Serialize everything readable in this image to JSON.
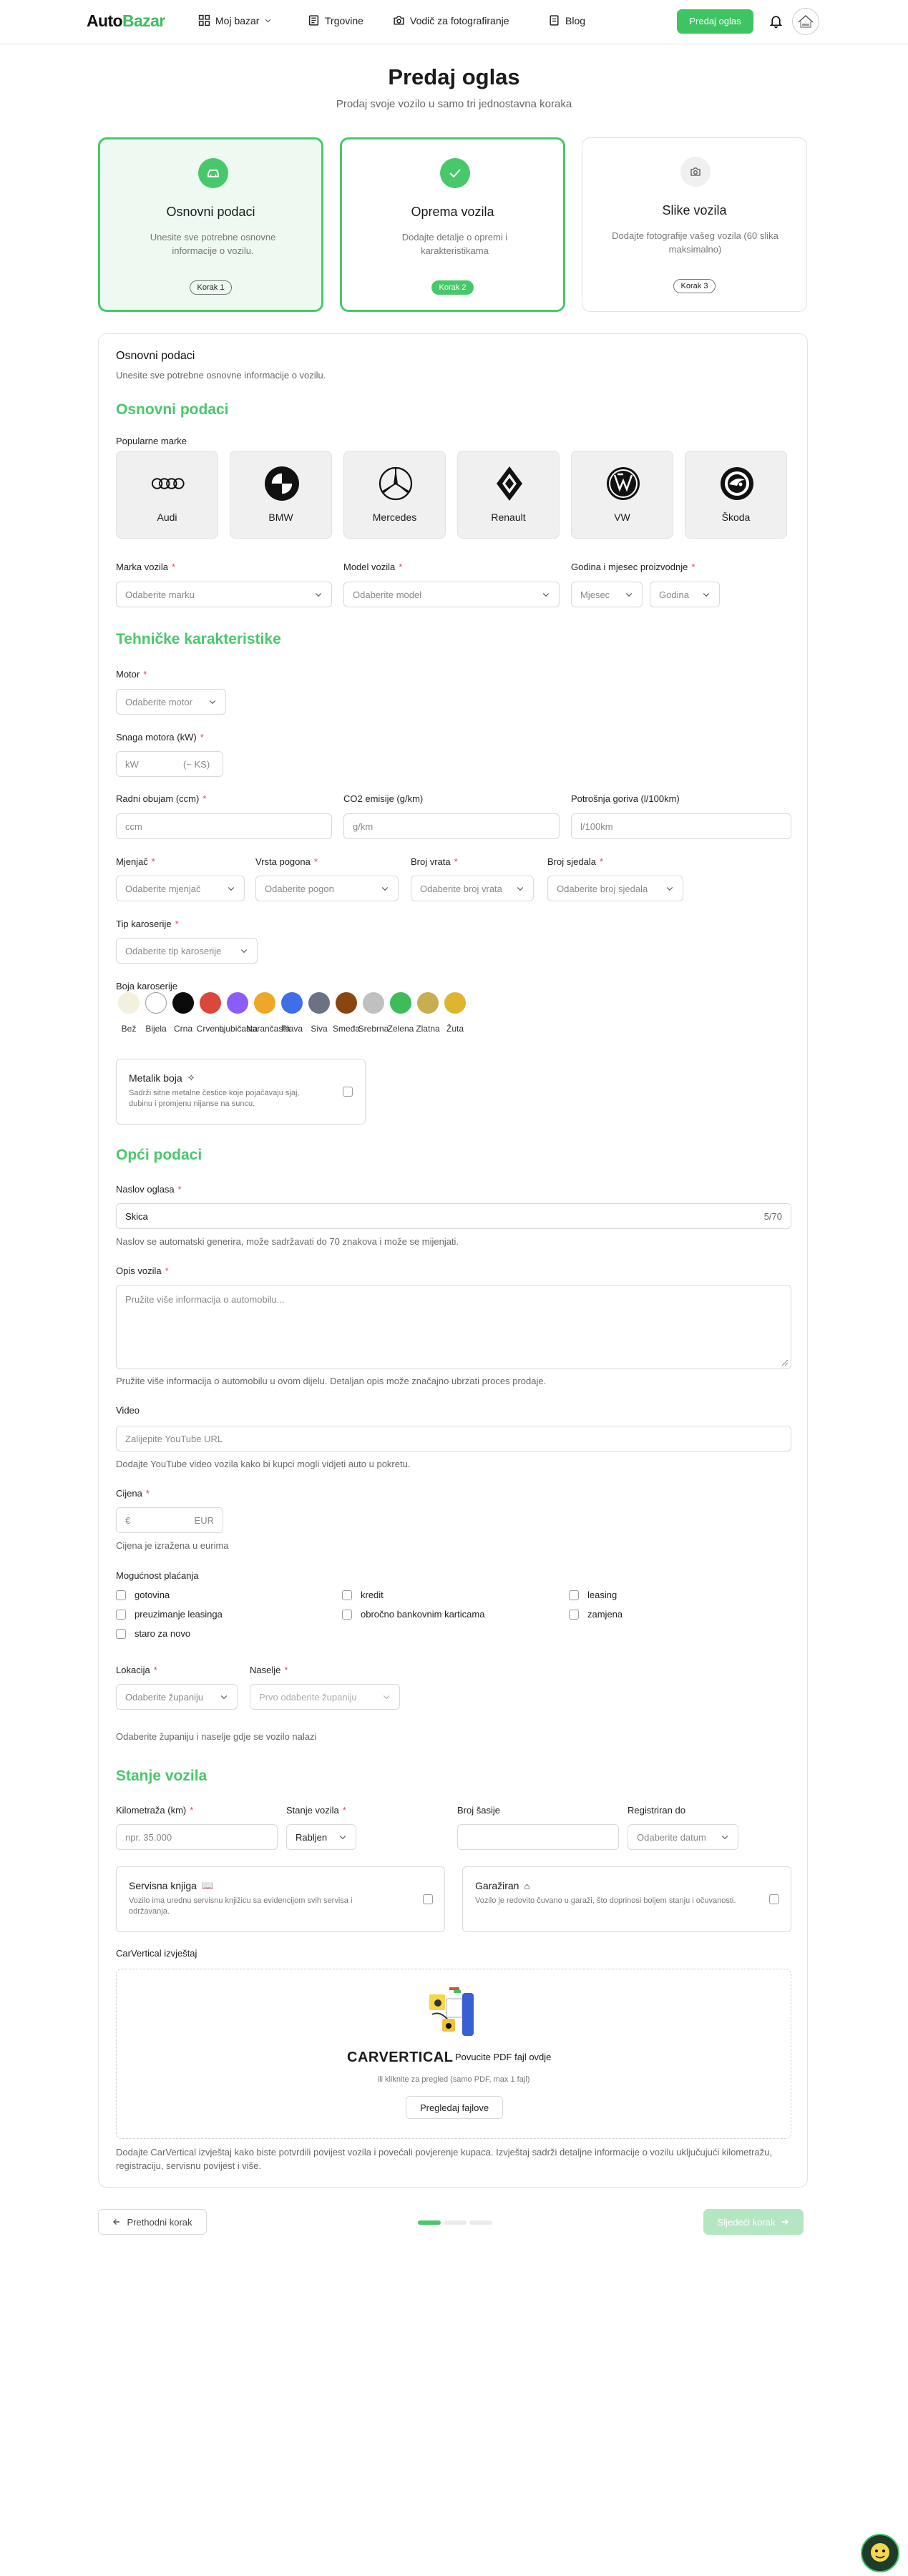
{
  "nav": {
    "logo_a": "Auto",
    "logo_b": "Bazar",
    "moj_bazar": "Moj bazar",
    "trgovine": "Trgovine",
    "vodic": "Vodič za fotografiranje",
    "blog": "Blog",
    "sell": "Predaj oglas"
  },
  "hero": {
    "title": "Predaj oglas",
    "subtitle": "Prodaj svoje vozilo u samo tri jednostavna koraka"
  },
  "steps": [
    {
      "title": "Osnovni podaci",
      "desc": "Unesite sve potrebne osnovne informacije o vozilu.",
      "badge": "Korak 1"
    },
    {
      "title": "Oprema vozila",
      "desc": "Dodajte detalje o opremi i karakteristikama",
      "badge": "Korak 2"
    },
    {
      "title": "Slike vozila",
      "desc": "Dodajte fotografije vašeg vozila (60 slika maksimalno)",
      "badge": "Korak 3"
    }
  ],
  "form": {
    "card_title": "Osnovni podaci",
    "card_sub": "Unesite sve potrebne osnovne informacije o vozilu.",
    "sec1": "Osnovni podaci",
    "popular": "Popularne marke",
    "brands": [
      "Audi",
      "BMW",
      "Mercedes",
      "Renault",
      "VW",
      "Škoda"
    ],
    "marka_label": "Marka vozila",
    "marka_ph": "Odaberite marku",
    "model_label": "Model vozila",
    "model_ph": "Odaberite model",
    "godina_label": "Godina i mjesec proizvodnje",
    "mjesec_ph": "Mjesec",
    "godina_ph": "Godina",
    "sec2": "Tehničke karakteristike",
    "motor_label": "Motor",
    "motor_ph": "Odaberite motor",
    "snaga_label": "Snaga motora (kW)",
    "kw_ph": "kW",
    "ks": "(~ KS)",
    "obujam_label": "Radni obujam (ccm)",
    "obujam_ph": "ccm",
    "co2_label": "CO2 emisije (g/km)",
    "co2_ph": "g/km",
    "potrosnja_label": "Potrošnja goriva (l/100km)",
    "potrosnja_ph": "l/100km",
    "mjenjac_label": "Mjenjač",
    "mjenjac_ph": "Odaberite mjenjač",
    "pogon_label": "Vrsta pogona",
    "pogon_ph": "Odaberite pogon",
    "vrata_label": "Broj vrata",
    "vrata_ph": "Odaberite broj vrata",
    "sjedala_label": "Broj sjedala",
    "sjedala_ph": "Odaberite broj sjedala",
    "karoserija_label": "Tip karoserije",
    "karoserija_ph": "Odaberite tip karoserije",
    "boja_label": "Boja karoserije",
    "colors": [
      {
        "name": "Bež",
        "hex": "#f3f0dd"
      },
      {
        "name": "Bijela",
        "hex": "#ffffff"
      },
      {
        "name": "Crna",
        "hex": "#0b0b0b"
      },
      {
        "name": "Crvena",
        "hex": "#d9483b"
      },
      {
        "name": "Ljubičasta",
        "hex": "#8b5cf6"
      },
      {
        "name": "Narančasta",
        "hex": "#eea727"
      },
      {
        "name": "Plava",
        "hex": "#3f6fe8"
      },
      {
        "name": "Siva",
        "hex": "#6d7283"
      },
      {
        "name": "Smeđa",
        "hex": "#8a4511"
      },
      {
        "name": "Srebrna",
        "hex": "#c0c0c0"
      },
      {
        "name": "Zelena",
        "hex": "#3fbb5a"
      },
      {
        "name": "Zlatna",
        "hex": "#c9ad53"
      },
      {
        "name": "Žuta",
        "hex": "#ddb52f"
      }
    ],
    "metalik_title": "Metalik boja",
    "metalik_desc": "Sadrži sitne metalne čestice koje pojačavaju sjaj, dubinu i promjenu nijanse na suncu.",
    "sec3": "Opći podaci",
    "naslov_label": "Naslov oglasa",
    "naslov_value": "Skica",
    "naslov_count": "5/70",
    "naslov_help": "Naslov se automatski generira, može sadržavati do 70 znakova i može se mijenjati.",
    "opis_label": "Opis vozila",
    "opis_ph": "Pružite više informacija o automobilu...",
    "opis_help": "Pružite više informacija o automobilu u ovom dijelu. Detaljan opis može značajno ubrzati proces prodaje.",
    "video_label": "Video",
    "video_ph": "Zalijepite YouTube URL",
    "video_help": "Dodajte YouTube video vozila kako bi kupci mogli vidjeti auto u pokretu.",
    "cijena_label": "Cijena",
    "cijena_sym": "€",
    "cijena_cur": "EUR",
    "cijena_help": "Cijena je izražena u eurima",
    "placanje_label": "Mogućnost plaćanja",
    "placanje": [
      "gotovina",
      "kredit",
      "leasing",
      "preuzimanje leasinga",
      "obročno bankovnim karticama",
      "zamjena",
      "staro za novo"
    ],
    "lokacija_label": "Lokacija",
    "lokacija_ph": "Odaberite županiju",
    "naselje_label": "Naselje",
    "naselje_ph": "Prvo odaberite županiju",
    "lokacija_help": "Odaberite županiju i naselje gdje se vozilo nalazi",
    "sec4": "Stanje vozila",
    "km_label": "Kilometraža (km)",
    "km_ph": "npr. 35.000",
    "stanje_label": "Stanje vozila",
    "stanje_value": "Rabljen",
    "sasija_label": "Broj šasije",
    "reg_label": "Registriran do",
    "reg_ph": "Odaberite datum",
    "servis_title": "Servisna knjiga",
    "servis_desc": "Vozilo ima urednu servisnu knjižicu sa evidencijom svih servisa i održavanja.",
    "garaza_title": "Garažiran",
    "garaza_desc": "Vozilo je redovito čuvano u garaži, što doprinosi boljem stanju i očuvanosti.",
    "cv_label": "CarVertical izvještaj",
    "cv_logo": "CARVERTICAL",
    "cv_upload": "Povucite PDF fajl ovdje",
    "cv_sub": "ili kliknite za pregled (samo PDF, max 1 fajl)",
    "cv_btn": "Pregledaj fajlove",
    "cv_help": "Dodajte CarVertical izvještaj kako biste potvrdili povijest vozila i povećali povjerenje kupaca. Izvještaj sadrži detaljne informacije o vozilu uključujući kilometražu, registraciju, servisnu povijest i više."
  },
  "footer": {
    "prev": "Prethodni korak",
    "next": "Sljedeći korak"
  },
  "accent": "#48c86b"
}
